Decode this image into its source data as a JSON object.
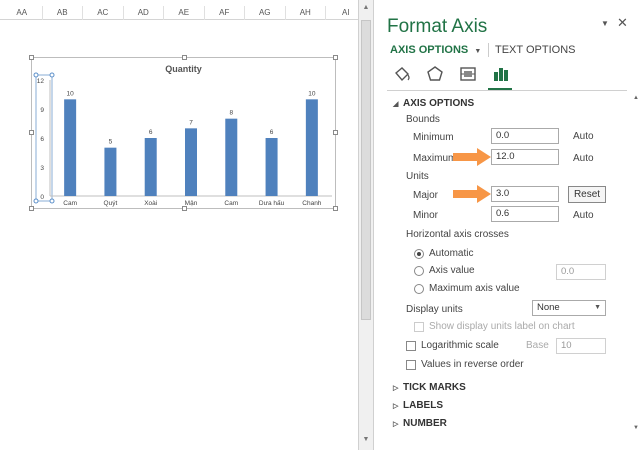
{
  "sheet": {
    "columns": [
      "AA",
      "AB",
      "AC",
      "AD",
      "AE",
      "AF",
      "AG",
      "AH",
      "AI"
    ]
  },
  "chart": {
    "title": "Quantity",
    "colors": {
      "bar": "#4f81bd",
      "axis": "#bfbfbf",
      "tick_text": "#444444"
    }
  },
  "chart_data": {
    "type": "bar",
    "title": "Quantity",
    "categories": [
      "Cam",
      "Quýt",
      "Xoài",
      "Mận",
      "Cam",
      "Dưa hấu",
      "Chanh"
    ],
    "values": [
      10,
      5,
      6,
      7,
      8,
      6,
      10
    ],
    "y_ticks": [
      "0",
      "3",
      "6",
      "9",
      "12"
    ],
    "ylim": [
      0,
      12
    ],
    "major_unit": 3,
    "grid": false,
    "legend": "none"
  },
  "pane": {
    "title": "Format Axis",
    "dropdown_icon": "chevron-down-icon",
    "close_icon": "close-icon",
    "tab_axis_options": "AXIS OPTIONS",
    "tab_text_options": "TEXT OPTIONS",
    "icons": [
      "fill-line-icon",
      "effects-icon",
      "size-properties-icon",
      "axis-options-icon"
    ],
    "accent": "#217346",
    "axis_options_header": "AXIS OPTIONS",
    "bounds_label": "Bounds",
    "minimum_label": "Minimum",
    "minimum_value": "0.0",
    "minimum_auto": "Auto",
    "maximum_label": "Maximum",
    "maximum_value": "12.0",
    "maximum_auto": "Auto",
    "units_label": "Units",
    "major_label": "Major",
    "major_value": "3.0",
    "major_reset": "Reset",
    "minor_label": "Minor",
    "minor_value": "0.6",
    "minor_auto": "Auto",
    "crosses_label": "Horizontal axis crosses",
    "automatic_label": "Automatic",
    "axis_value_label": "Axis value",
    "axis_value_value": "0.0",
    "max_axis_value_label": "Maximum axis value",
    "display_units_label": "Display units",
    "display_units_value": "None",
    "show_units_label": "Show display units label on chart",
    "log_scale_label": "Logarithmic scale",
    "base_label": "Base",
    "base_value": "10",
    "reverse_label": "Values in reverse order",
    "tick_marks_header": "TICK MARKS",
    "labels_header": "LABELS",
    "number_header": "NUMBER",
    "arrow_color": "#f79646"
  }
}
